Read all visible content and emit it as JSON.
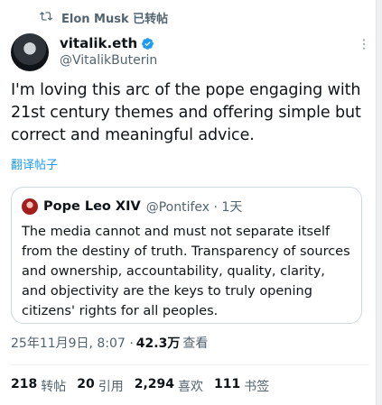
{
  "repost": {
    "text": "Elon Musk 已转帖"
  },
  "author": {
    "display_name": "vitalik.eth",
    "handle": "@VitalikButerin"
  },
  "tweet": {
    "text": "I'm loving this arc of the pope engaging with 21st century themes and offering simple but correct and meaningful advice.",
    "translate_label": "翻译帖子"
  },
  "quote": {
    "name": "Pope Leo XIV",
    "handle_time": "@Pontifex · 1天",
    "text": "The media cannot and must not separate itself from the destiny of truth. Transparency of sources and ownership, accountability, quality, clarity, and objectivity are the keys to truly opening citizens' rights for all peoples."
  },
  "meta": {
    "timestamp": "25年11月9日, 8:07 ·",
    "views_count": "42.3万",
    "views_label": "查看"
  },
  "stats": {
    "reposts": {
      "count": "218",
      "label": "转帖"
    },
    "quotes": {
      "count": "20",
      "label": "引用"
    },
    "likes": {
      "count": "2,294",
      "label": "喜欢"
    },
    "bookmarks": {
      "count": "111",
      "label": "书签"
    }
  },
  "colors": {
    "accent": "#1d9bf0",
    "muted": "#536471",
    "text": "#0f1419",
    "border": "#cfd9de"
  },
  "icons": {
    "repost": "repost-icon",
    "verified": "verified-badge-icon",
    "more": "more-options-icon"
  }
}
